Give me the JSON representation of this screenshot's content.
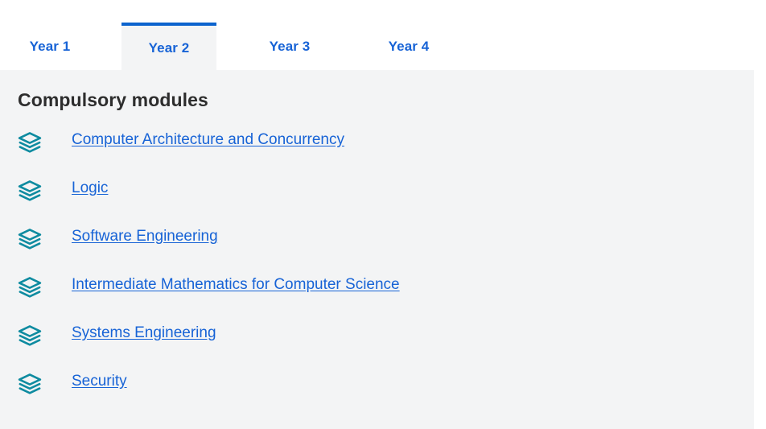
{
  "tabs": {
    "items": [
      {
        "label": "Year 1",
        "active": false
      },
      {
        "label": "Year 2",
        "active": true
      },
      {
        "label": "Year 3",
        "active": false
      },
      {
        "label": "Year 4",
        "active": false
      }
    ]
  },
  "content": {
    "heading": "Compulsory modules",
    "module_icon": "layers-icon",
    "modules": [
      {
        "label": "Computer Architecture and Concurrency"
      },
      {
        "label": "Logic"
      },
      {
        "label": "Software Engineering"
      },
      {
        "label": "Intermediate Mathematics for Computer Science"
      },
      {
        "label": "Systems Engineering"
      },
      {
        "label": "Security"
      }
    ]
  },
  "colors": {
    "link": "#1763d6",
    "active_tab_border": "#0b63ce",
    "panel_background": "#f3f4f5",
    "icon_teal": "#0e8ba0",
    "heading": "#2d2d2d",
    "page_background": "#ffffff"
  }
}
